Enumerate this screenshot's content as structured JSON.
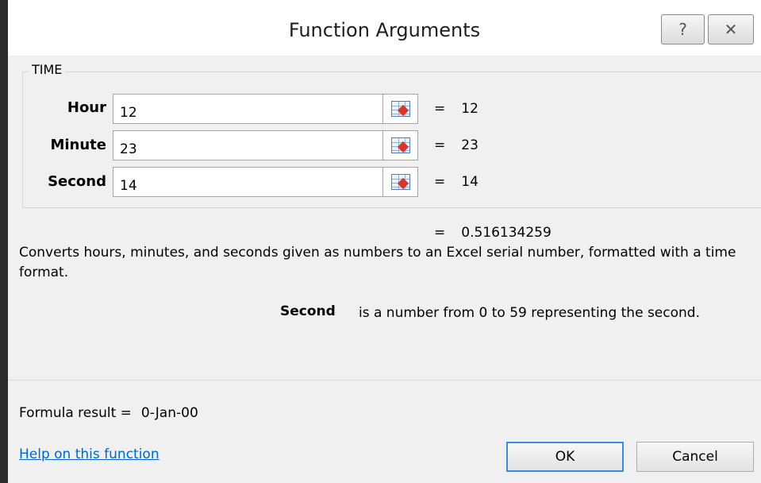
{
  "window": {
    "title": "Function Arguments",
    "help_glyph": "?",
    "close_glyph": "✕"
  },
  "function_name": "TIME",
  "arguments": [
    {
      "label": "Hour",
      "value": "12",
      "result_eq": "=",
      "result": "12"
    },
    {
      "label": "Minute",
      "value": "23",
      "result_eq": "=",
      "result": "23"
    },
    {
      "label": "Second",
      "value": "14",
      "result_eq": "=",
      "result": "14"
    }
  ],
  "overall_result": {
    "eq": "=",
    "value": "0.516134259"
  },
  "description": "Converts hours, minutes, and seconds given as numbers to an Excel serial number, formatted with a time format.",
  "param_help": {
    "name": "Second",
    "text": "is a number from 0 to 59 representing the second."
  },
  "formula_result": {
    "label": "Formula result =",
    "value": "0-Jan-00"
  },
  "help_link": "Help on this function",
  "buttons": {
    "ok": "OK",
    "cancel": "Cancel"
  },
  "icons": {
    "help": "question-icon",
    "close": "close-icon",
    "ref": "collapse-dialog-icon"
  }
}
